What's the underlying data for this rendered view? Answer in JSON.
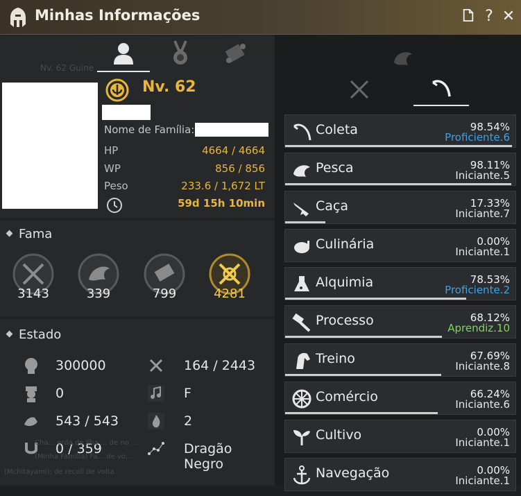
{
  "window": {
    "title": "Minhas Informações"
  },
  "profile": {
    "level": "Nv. 62",
    "family_label": "Nome de Família:",
    "stats": [
      {
        "key": "HP",
        "value": "4664 / 4664"
      },
      {
        "key": "WP",
        "value": "856 / 856"
      },
      {
        "key": "Peso",
        "value": "233.6 / 1,672 LT"
      }
    ],
    "playtime": "59d 15h 10min"
  },
  "fama": {
    "title": "Fama",
    "items": [
      {
        "icon": "combat-fame-icon",
        "value": "3143"
      },
      {
        "icon": "life-fame-icon",
        "value": "339"
      },
      {
        "icon": "contribution-fame-icon",
        "value": "799"
      },
      {
        "icon": "total-fame-icon",
        "value": "4281",
        "highlight": "#f2c94c"
      }
    ]
  },
  "estado": {
    "title": "Estado",
    "items": [
      {
        "icon": "energy-icon",
        "value": "300000"
      },
      {
        "icon": "crossed-axes-icon",
        "value": "164 / 2443"
      },
      {
        "icon": "officer-icon",
        "value": "0"
      },
      {
        "icon": "music-note-icon",
        "value": "F"
      },
      {
        "icon": "strength-icon",
        "value": "543 / 543"
      },
      {
        "icon": "flame-icon",
        "value": "2"
      },
      {
        "icon": "horseshoe-icon",
        "value": "0 / 359"
      },
      {
        "icon": "constellation-icon",
        "value": "Dragão Negro"
      }
    ]
  },
  "life_skills": [
    {
      "name": "Coleta",
      "pct": "98.54%",
      "rank": "Proficiente.6",
      "rank_color": "#3ea2e4",
      "progress": 0.9854,
      "icon": "sickle-icon"
    },
    {
      "name": "Pesca",
      "pct": "98.11%",
      "rank": "Iniciante.5",
      "rank_color": "#e8e8e8",
      "progress": 0.9811,
      "icon": "fish-icon"
    },
    {
      "name": "Caça",
      "pct": "17.33%",
      "rank": "Iniciante.7",
      "rank_color": "#e8e8e8",
      "progress": 0.1733,
      "icon": "rifle-icon"
    },
    {
      "name": "Culinária",
      "pct": "0.00%",
      "rank": "Iniciante.1",
      "rank_color": "#e8e8e8",
      "progress": 0.0,
      "icon": "chicken-icon"
    },
    {
      "name": "Alquimia",
      "pct": "78.53%",
      "rank": "Proficiente.2",
      "rank_color": "#3ea2e4",
      "progress": 0.7853,
      "icon": "flask-icon"
    },
    {
      "name": "Processo",
      "pct": "68.12%",
      "rank": "Aprendiz.10",
      "rank_color": "#7fd65a",
      "progress": 0.6812,
      "icon": "hammer-icon"
    },
    {
      "name": "Treino",
      "pct": "67.69%",
      "rank": "Iniciante.8",
      "rank_color": "#e8e8e8",
      "progress": 0.6769,
      "icon": "horse-icon"
    },
    {
      "name": "Comércio",
      "pct": "66.24%",
      "rank": "Iniciante.6",
      "rank_color": "#e8e8e8",
      "progress": 0.6624,
      "icon": "wheel-icon"
    },
    {
      "name": "Cultivo",
      "pct": "0.00%",
      "rank": "Iniciante.1",
      "rank_color": "#e8e8e8",
      "progress": 0.0,
      "icon": "sprout-icon"
    },
    {
      "name": "Navegação",
      "pct": "0.00%",
      "rank": "Iniciante.1",
      "rank_color": "#e8e8e8",
      "progress": 0.0,
      "icon": "anchor-icon"
    }
  ],
  "background_ghost": {
    "top_left": "Nv. 62 Guine",
    "lines": [
      "Cha... erda de Ilha ... de no ...",
      "(Minha Família) Fa... de vo...",
      "(Mchitayami): de recoll de volta"
    ]
  },
  "colors": {
    "accent_gold": "#e8b63a",
    "proficient_blue": "#3ea2e4",
    "apprentice_green": "#7fd65a"
  }
}
